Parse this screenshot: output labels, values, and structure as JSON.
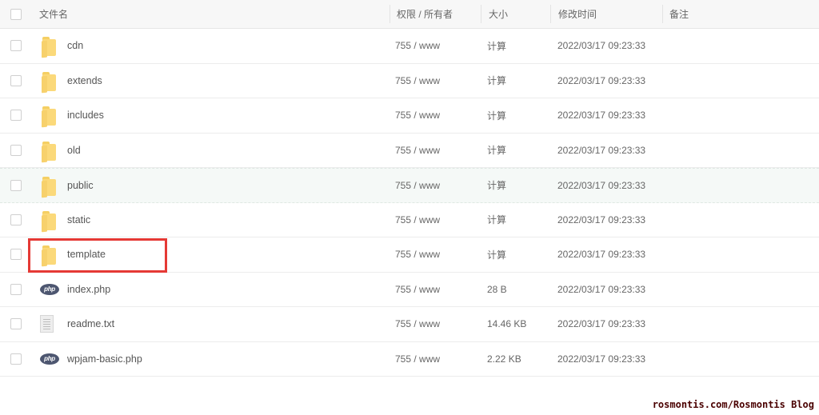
{
  "header": {
    "name": "文件名",
    "permission": "权限 / 所有者",
    "size": "大小",
    "modified": "修改时间",
    "note": "备注"
  },
  "rows": [
    {
      "name": "cdn",
      "type": "folder",
      "perm": "755 / www",
      "size": "计算",
      "time": "2022/03/17 09:23:33"
    },
    {
      "name": "extends",
      "type": "folder",
      "perm": "755 / www",
      "size": "计算",
      "time": "2022/03/17 09:23:33"
    },
    {
      "name": "includes",
      "type": "folder",
      "perm": "755 / www",
      "size": "计算",
      "time": "2022/03/17 09:23:33"
    },
    {
      "name": "old",
      "type": "folder",
      "perm": "755 / www",
      "size": "计算",
      "time": "2022/03/17 09:23:33"
    },
    {
      "name": "public",
      "type": "folder",
      "perm": "755 / www",
      "size": "计算",
      "time": "2022/03/17 09:23:33"
    },
    {
      "name": "static",
      "type": "folder",
      "perm": "755 / www",
      "size": "计算",
      "time": "2022/03/17 09:23:33"
    },
    {
      "name": "template",
      "type": "folder",
      "perm": "755 / www",
      "size": "计算",
      "time": "2022/03/17 09:23:33"
    },
    {
      "name": "index.php",
      "type": "php",
      "perm": "755 / www",
      "size": "28 B",
      "time": "2022/03/17 09:23:33"
    },
    {
      "name": "readme.txt",
      "type": "txt",
      "perm": "755 / www",
      "size": "14.46 KB",
      "time": "2022/03/17 09:23:33"
    },
    {
      "name": "wpjam-basic.php",
      "type": "php",
      "perm": "755 / www",
      "size": "2.22 KB",
      "time": "2022/03/17 09:23:33"
    }
  ],
  "php_icon_text": "php",
  "highlight_color": "#e53935",
  "watermark": "rosmontis.com/Rosmontis Blog"
}
